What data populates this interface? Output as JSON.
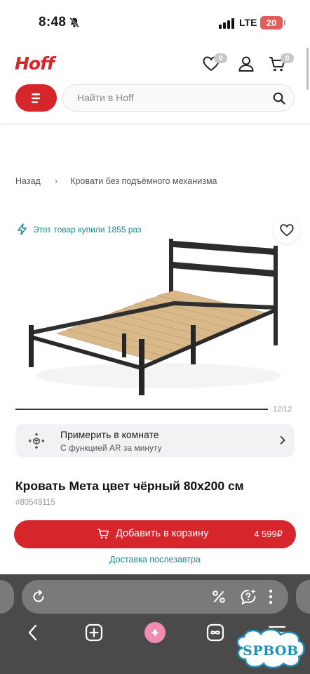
{
  "status_bar": {
    "time": "8:48",
    "network": "LTE",
    "battery": "20",
    "icons": [
      "bell-off-icon",
      "signal-icon"
    ]
  },
  "header": {
    "logo": "Hoff",
    "favorites_count": "0",
    "cart_count": "0",
    "search_placeholder": "Найти в Hoff",
    "icons": [
      "heart-icon",
      "user-icon",
      "cart-icon",
      "menu-icon",
      "search-icon"
    ]
  },
  "breadcrumb": {
    "back": "Назад",
    "category": "Кровати без подъёмного механизма"
  },
  "product": {
    "bought_text": "Этот товар купили 1855 раз",
    "image_counter": "12/12",
    "title": "Кровать Мета цвет чёрный 80x200 см",
    "sku": "#80549115",
    "add_to_cart_label": "Добавить в корзину",
    "price": "4 599₽",
    "delivery": "Доставка послезавтра"
  },
  "ar": {
    "title": "Примерить в комнате",
    "subtitle": "С  функцией AR за минуту"
  },
  "browser": {
    "icons": [
      "reload-icon",
      "percent-icon",
      "chat-icon",
      "more-icon",
      "back-icon",
      "new-tab-icon",
      "alice-icon",
      "tabs-icon",
      "menu-icon"
    ]
  },
  "watermark": "SPBOB",
  "colors": {
    "brand_red": "#d6262b",
    "teal": "#1f8a8f",
    "browser_bar": "#4a4a4a"
  }
}
